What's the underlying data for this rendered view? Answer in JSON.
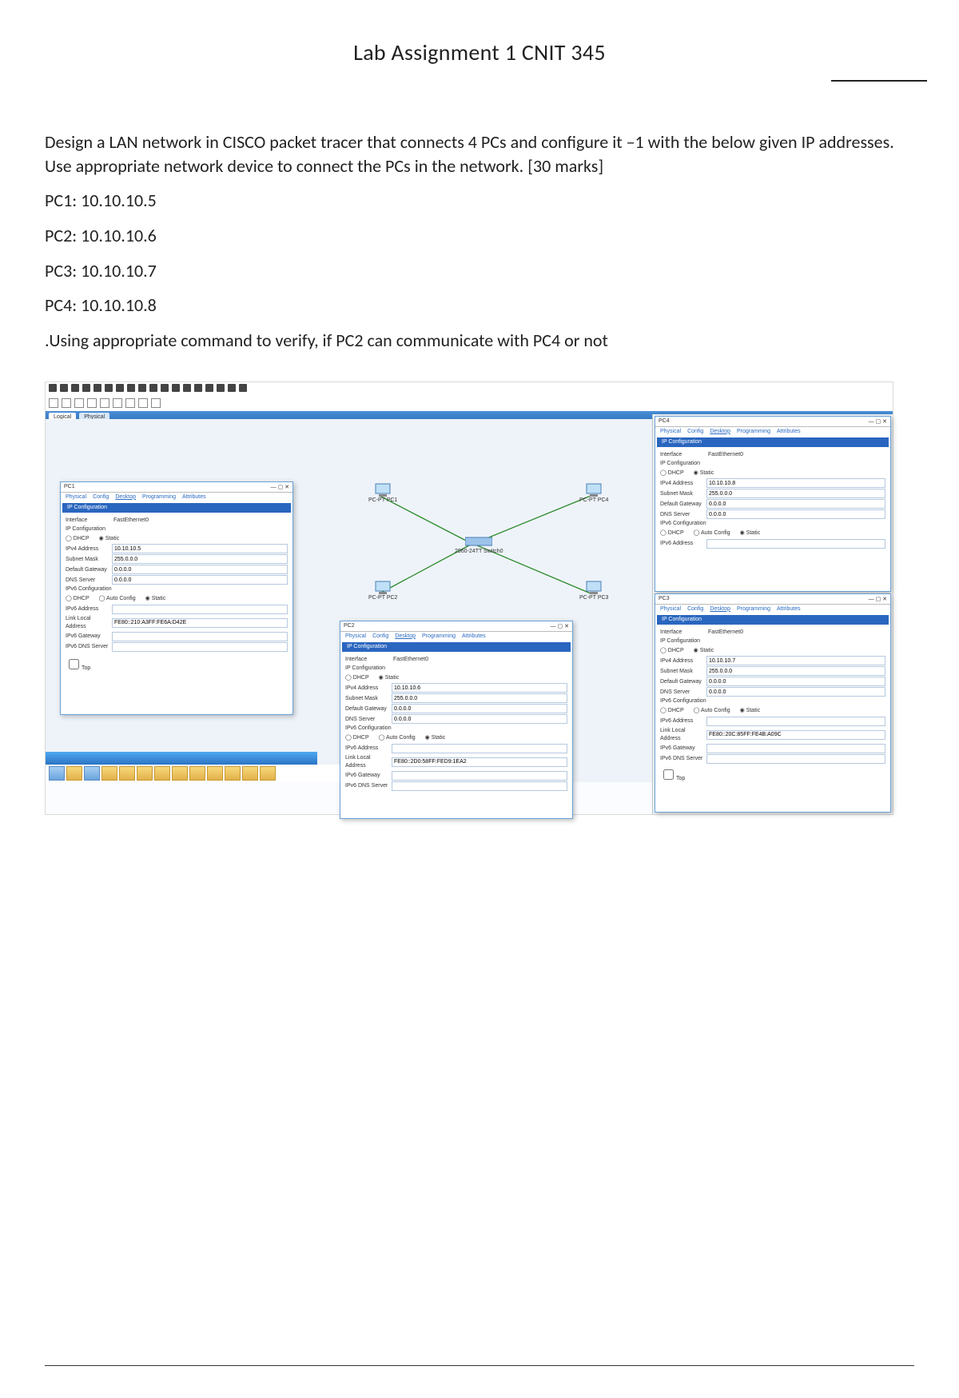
{
  "document": {
    "title": "Lab Assignment 1 CNIT 345",
    "instructions": "Design a LAN network in CISCO packet tracer that connects 4 PCs and configure it –1 with the below given IP addresses. Use appropriate network device to connect the PCs in the network. [30 marks]",
    "pc_addresses": {
      "pc1": "PC1: 10.10.10.5",
      "pc2": "PC2: 10.10.10.6",
      "pc3": "PC3: 10.10.10.7",
      "pc4": "PC4: 10.10.10.8"
    },
    "verify": ".Using appropriate command to verify, if PC2 can communicate with PC4 or not"
  },
  "packet_tracer": {
    "view_tabs": {
      "logical": "Logical",
      "physical": "Physical"
    },
    "topology": {
      "pc1_label": "PC-PT\nPC1",
      "pc2_label": "PC-PT\nPC2",
      "pc3_label": "PC-PT\nPC3",
      "pc4_label": "PC-PT\nPC4",
      "switch_label": "2960-24TT\nSwitch0"
    },
    "common": {
      "tabs": {
        "physical": "Physical",
        "config": "Config",
        "desktop": "Desktop",
        "programming": "Programming",
        "attributes": "Attributes"
      },
      "header": "IP Configuration",
      "interface_lbl": "Interface",
      "interface_val": "FastEthernet0",
      "ipconf": "IP Configuration",
      "dhcp": "DHCP",
      "static": "Static",
      "autoconfig": "Auto Config",
      "ipv4": "IPv4 Address",
      "subnet": "Subnet Mask",
      "gateway": "Default Gateway",
      "dns": "DNS Server",
      "ipv6conf": "IPv6 Configuration",
      "ipv6": "IPv6 Address",
      "lla": "Link Local Address",
      "ipv6gw": "IPv6 Gateway",
      "ipv6dns": "IPv6 DNS Server",
      "top": "Top"
    },
    "pc1_win": {
      "title": "PC1",
      "values": {
        "ip": "10.10.10.5",
        "mask": "255.0.0.0",
        "gw": "0.0.0.0",
        "dns": "0.0.0.0",
        "lla": "FE80::210:A3FF:FE6A:D42E"
      }
    },
    "pc2_win": {
      "title": "PC2",
      "values": {
        "ip": "10.10.10.6",
        "mask": "255.0.0.0",
        "gw": "0.0.0.0",
        "dns": "0.0.0.0",
        "lla": "FE80::2D0:58FF:FED9:1EA2"
      }
    },
    "pc3_win": {
      "title": "PC3",
      "values": {
        "ip": "10.10.10.7",
        "mask": "255.0.0.0",
        "gw": "0.0.0.0",
        "dns": "0.0.0.0",
        "lla": "FE80::20C:85FF:FE4B:A09C"
      }
    },
    "pc4_win": {
      "title": "PC4",
      "values": {
        "ip": "10.10.10.8",
        "mask": "255.0.0.0",
        "gw": "0.0.0.0",
        "dns": "0.0.0.0"
      }
    }
  }
}
